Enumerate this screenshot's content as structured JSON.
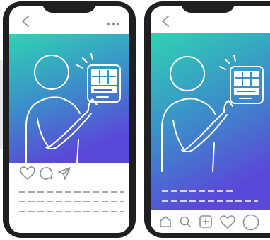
{
  "background": {
    "chevron_color": "#e6e7ea"
  },
  "colors": {
    "phone_frame": "#1f1f21",
    "gradient_top": "#2fd3b3",
    "gradient_mid": "#3a93c8",
    "gradient_bottom": "#5a48d9",
    "line_art": "#ffffff",
    "icon_stroke": "#8a8d93",
    "dash_stroke": "#8a8d93"
  },
  "phones": [
    {
      "name": "post-view",
      "top_bar": {
        "icons": [
          "back-chevron-icon",
          "more-options-icon"
        ]
      },
      "media": {
        "illustration": "person-holding-tablet"
      },
      "actions": {
        "icons": [
          "like-heart-icon",
          "comment-bubble-icon",
          "share-send-icon"
        ]
      },
      "caption_lines": 3
    },
    {
      "name": "story-view",
      "top_bar": {
        "icons": [
          "back-chevron-icon"
        ]
      },
      "media": {
        "illustration": "person-holding-tablet"
      },
      "caption_lines": 2,
      "bottom_nav": {
        "icons": [
          "home-icon",
          "search-icon",
          "new-post-icon",
          "activity-heart-icon",
          "profile-icon"
        ]
      }
    }
  ]
}
